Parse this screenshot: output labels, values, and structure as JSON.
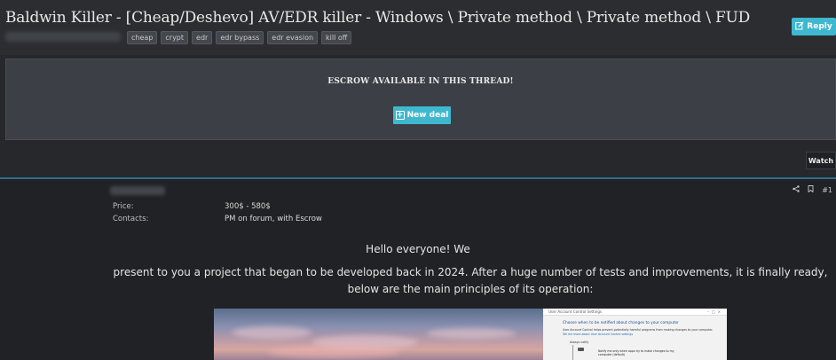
{
  "thread": {
    "title": "Baldwin Killer - [Cheap/Deshevo] AV/EDR killer - Windows \\ Private method \\ Private method \\ FUD",
    "tags": [
      "cheap",
      "crypt",
      "edr",
      "edr bypass",
      "edr evasion",
      "kill off"
    ],
    "reply_label": "Reply"
  },
  "escrow": {
    "message": "ESCROW AVAILABLE IN THIS THREAD!",
    "new_deal_label": "New deal"
  },
  "watch_label": "Watch",
  "post": {
    "number": "#1",
    "fields": [
      {
        "label": "Price:",
        "value": "300$ - 580$"
      },
      {
        "label": "Contacts:",
        "value": "PM on forum, with Escrow"
      }
    ],
    "greeting": "Hello everyone! We",
    "intro": "present to you a project that began to be developed back in 2024. After a huge number of tests and improvements, it is finally ready, below are the main principles of its operation:",
    "uac_window": {
      "title": "User Account Control Settings",
      "heading": "Choose when to be notified about changes to your computer",
      "description": "User Account Control helps prevent potentially harmful programs from making changes to your computer.",
      "link": "Tell me more about User Account Control settings",
      "slider_top_label": "Always notify",
      "note_line1": "Notify me only when apps try to make changes to my",
      "note_line2": "computer (default)"
    }
  }
}
